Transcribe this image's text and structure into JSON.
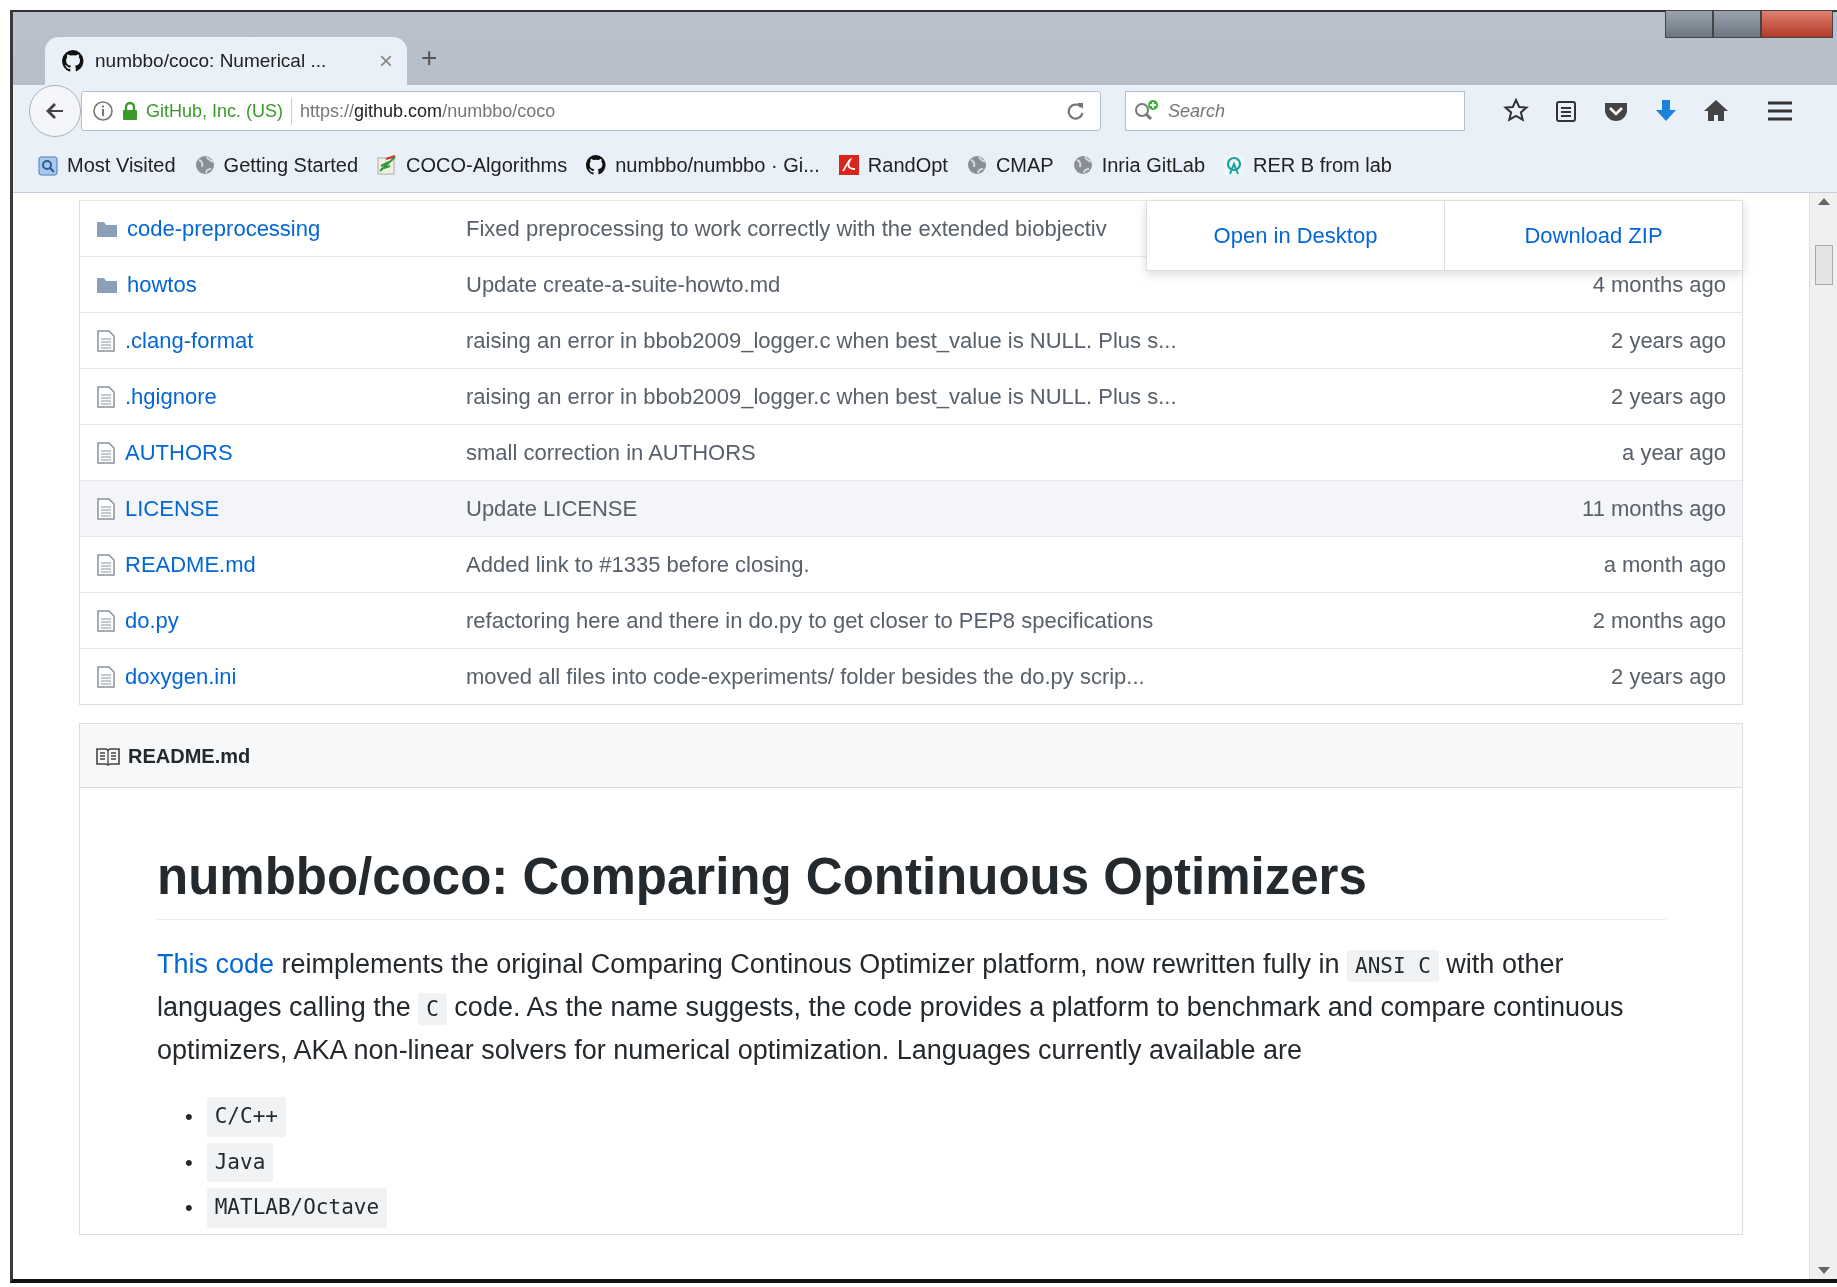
{
  "tabs": [
    {
      "title": "numbbo/coco: Numerical ...",
      "close": "×",
      "selected": true
    }
  ],
  "new_tab": "+",
  "nav": {
    "identity": "GitHub, Inc. (US)",
    "url": "https://**github.com**/numbbo/coco",
    "search_placeholder": "Search"
  },
  "bookmarks": [
    {
      "label": "Most Visited",
      "kind": "folder"
    },
    {
      "label": "Getting Started",
      "kind": "globe"
    },
    {
      "label": "COCO-Algorithms",
      "kind": "pencil"
    },
    {
      "label": "numbbo/numbbo · Gi...",
      "kind": "github"
    },
    {
      "label": "RandOpt",
      "kind": "adobe"
    },
    {
      "label": "CMAP",
      "kind": "globe"
    },
    {
      "label": "Inria GitLab",
      "kind": "globe"
    },
    {
      "label": "RER B from lab",
      "kind": "transit"
    }
  ],
  "files": [
    {
      "name": "code-preprocessing",
      "kind": "folder",
      "message": "Fixed preprocessing to work correctly with the extended biobjectiv",
      "hovered": false
    },
    {
      "name": "howtos",
      "kind": "folder",
      "message": "Update create-a-suite-howto.md",
      "age": "4 months ago",
      "hovered": false
    },
    {
      "name": ".clang-format",
      "kind": "file",
      "message": "raising an error in bbob2009_logger.c when best_value is NULL. Plus s...",
      "age": "2 years ago",
      "hovered": false
    },
    {
      "name": ".hgignore",
      "kind": "file",
      "message": "raising an error in bbob2009_logger.c when best_value is NULL. Plus s...",
      "age": "2 years ago",
      "hovered": false
    },
    {
      "name": "AUTHORS",
      "kind": "file",
      "message": "small correction in AUTHORS",
      "age": "a year ago",
      "hovered": false
    },
    {
      "name": "LICENSE",
      "kind": "file",
      "message": "Update LICENSE",
      "age": "11 months ago",
      "hovered": true
    },
    {
      "name": "README.md",
      "kind": "file",
      "message": "Added link to #1335 before closing.",
      "age": "a month ago",
      "hovered": false
    },
    {
      "name": "do.py",
      "kind": "file",
      "message": "refactoring here and there in do.py to get closer to PEP8 specifications",
      "age": "2 months ago",
      "hovered": false
    },
    {
      "name": "doxygen.ini",
      "kind": "file",
      "message": "moved all files into code-experiments/ folder besides the do.py scrip...",
      "age": "2 years ago",
      "hovered": false
    }
  ],
  "clone_menu": {
    "buttons": [
      "Open in Desktop",
      "Download ZIP"
    ]
  },
  "readme": {
    "filename": "README.md",
    "heading": "numbbo/coco: Comparing Continuous Optimizers",
    "paragraph": [
      {
        "kind": "link",
        "text": "This code"
      },
      {
        "kind": "text",
        "text": " reimplements the original Comparing Continous Optimizer platform, now rewritten fully in "
      },
      {
        "kind": "code",
        "text": "ANSI C"
      },
      {
        "kind": "text",
        "text": " with other languages calling the "
      },
      {
        "kind": "code",
        "text": "C"
      },
      {
        "kind": "text",
        "text": " code. As the name suggests, the code provides a platform to benchmark and compare continuous optimizers, AKA non-linear solvers for numerical optimization. Languages currently available are"
      }
    ],
    "languages": [
      {
        "bullet": "•",
        "code": "C/C++"
      },
      {
        "bullet": "•",
        "code": "Java"
      },
      {
        "bullet": "•",
        "code": "MATLAB/Octave"
      }
    ]
  }
}
